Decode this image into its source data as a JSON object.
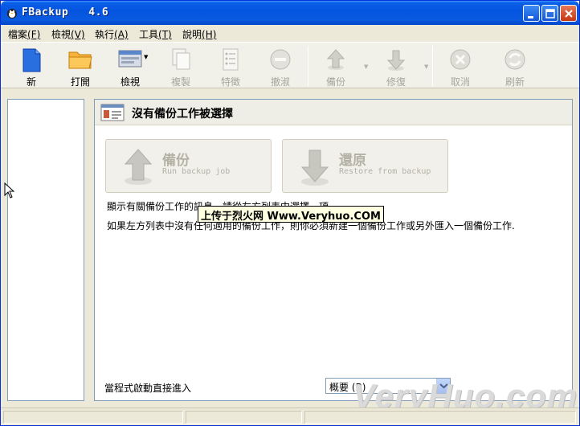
{
  "window": {
    "title": "FBackup   4.6",
    "controls": {
      "minimize": "minimize",
      "maximize": "maximize",
      "close": "close"
    }
  },
  "menu": [
    {
      "label": "檔案",
      "key": "(F)"
    },
    {
      "label": "檢視",
      "key": "(V)"
    },
    {
      "label": "執行",
      "key": "(A)"
    },
    {
      "label": "工具",
      "key": "(T)"
    },
    {
      "label": "說明",
      "key": "(H)"
    }
  ],
  "toolbar": {
    "new": "新",
    "open": "打開",
    "view": "檢視",
    "copy": "複製",
    "properties": "特徵",
    "remove": "撤淑",
    "backup": "備份",
    "restore": "修復",
    "cancel": "取消",
    "refresh": "刷新"
  },
  "main": {
    "header_title": "沒有備份工作被選擇",
    "backup_btn": {
      "title": "備份",
      "subtitle": "Run backup job"
    },
    "restore_btn": {
      "title": "還原",
      "subtitle": "Restore from backup"
    },
    "info_line1": "顯示有關備份工作的訊息，請從左方列表中選擇一項",
    "info_line2": "如果左方列表中沒有任何適用的備份工作，則你必須新建一個備份工作或另外匯入一個備份工作.",
    "startup_label": "當程式啟動直接進入",
    "startup_value": "概要 (B)"
  },
  "overlay": {
    "watermark_text": "上传于烈火网 Www.Veryhuo.COM",
    "site_watermark": "VeryHuo.com"
  },
  "colors": {
    "titlebar": "#0554e0",
    "window_bg": "#ece9d8",
    "panel_border": "#7f9db9",
    "disabled_text": "#a7a69c"
  }
}
